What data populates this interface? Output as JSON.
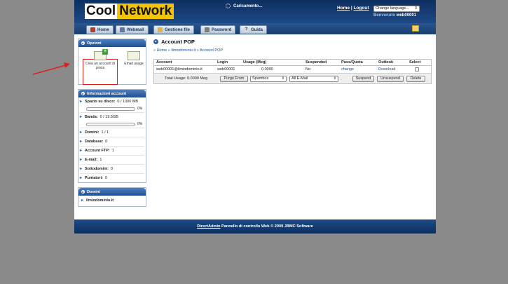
{
  "brand": {
    "part1": "Cool",
    "part2": "Network"
  },
  "header": {
    "loading": "Caricamento...",
    "home": "Home",
    "separator": "|",
    "logout": "Logout",
    "language": "Change language...",
    "welcome_label": "Benvenuto",
    "welcome_user": "web00001"
  },
  "nav": {
    "tabs": [
      {
        "label": "Home"
      },
      {
        "label": "Webmail"
      },
      {
        "label": "Gestione file"
      },
      {
        "label": "Password"
      },
      {
        "label": "Guida"
      }
    ]
  },
  "sidebar": {
    "options_title": "Opzioni",
    "create_account": "Crea un account di posta",
    "email_usage": "Email usage",
    "info_title": "Informazioni account",
    "disk_label": "Spazio su disco:",
    "disk_value": "0 / 1000 MB",
    "disk_pct": "0%",
    "band_label": "Banda:",
    "band_value": "0 / 19.5GB",
    "band_pct": "0%",
    "domini_label": "Domini:",
    "domini_value": "1 / 1",
    "database_label": "Database:",
    "database_value": "0",
    "ftp_label": "Account FTP:",
    "ftp_value": "1",
    "email_label": "E-mail:",
    "email_value": "1",
    "subdomain_label": "Sottodomini:",
    "subdomain_value": "0",
    "pointer_label": "Puntatori:",
    "pointer_value": "0",
    "domains_title": "Domini",
    "domain_name": "ilmiodominio.it"
  },
  "main": {
    "title": "Account POP",
    "breadcrumb": "» Home » ilmiodominio.it » Account POP",
    "columns": [
      "Account",
      "Login",
      "Usage (Meg)",
      "Suspended",
      "Pass/Quota",
      "Outlook",
      "Select"
    ],
    "row": {
      "account": "web00001@ilmiodominio.it",
      "login": "web00001",
      "usage": "0.0000",
      "suspended": "No",
      "passquota": "change",
      "outlook": "Download"
    },
    "total_usage": "Total Usage: 0.0000 Meg",
    "purge_from": "Purge From",
    "spambox": "Spambox",
    "all_email": "All E-Mail",
    "suspend": "Suspend",
    "unsuspend": "Unsuspend",
    "delete": "Delete"
  },
  "footer": {
    "link": "DirectAdmin",
    "text": " Pannello di controllo Web © 2009 JBMC Software"
  }
}
